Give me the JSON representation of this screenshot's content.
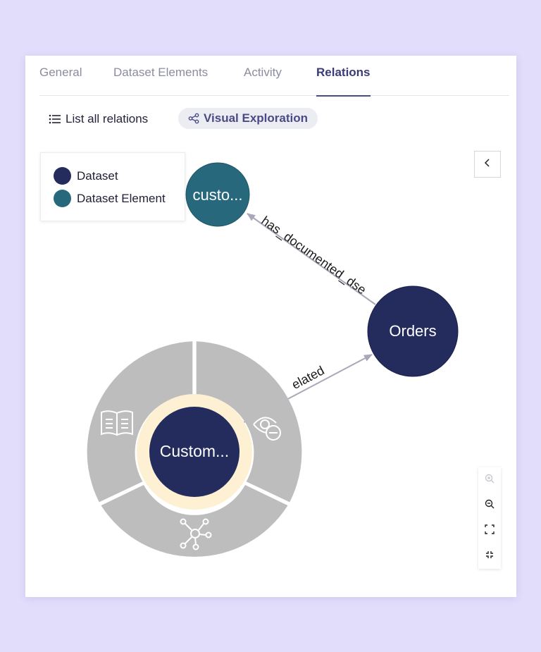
{
  "colors": {
    "background": "#e3ddfc",
    "dataset": "#242c5e",
    "dataset_element": "#27687d",
    "active_tab": "#3b3b78",
    "ring_highlight": "#fdf0d3",
    "radial_menu": "#bdbdbd",
    "edge": "#a8a8b8"
  },
  "tabs": [
    {
      "label": "General",
      "active": false
    },
    {
      "label": "Dataset Elements",
      "active": false
    },
    {
      "label": "Activity",
      "active": false
    },
    {
      "label": "Relations",
      "active": true
    }
  ],
  "subbar": {
    "list_label": "List all relations",
    "list_icon": "list-icon",
    "visual_label": "Visual Exploration",
    "visual_icon": "share-nodes-icon"
  },
  "legend": {
    "items": [
      {
        "label": "Dataset",
        "color_key": "dataset"
      },
      {
        "label": "Dataset Element",
        "color_key": "dataset_element"
      }
    ]
  },
  "graph": {
    "nodes": {
      "customers": {
        "label": "Custom...",
        "type": "Dataset"
      },
      "orders": {
        "label": "Orders",
        "type": "Dataset"
      },
      "customer_element": {
        "label": "custo...",
        "type": "Dataset Element"
      }
    },
    "edges": {
      "related": {
        "label": "elated"
      },
      "documented": {
        "label": "has_documented_dse"
      }
    },
    "radial_menu": {
      "items": [
        {
          "icon": "book-icon"
        },
        {
          "icon": "eye-hide-icon"
        },
        {
          "icon": "network-icon"
        }
      ]
    }
  },
  "controls": {
    "collapse_icon": "chevron-left-icon",
    "zoom": [
      {
        "icon": "zoom-in-icon",
        "enabled": false
      },
      {
        "icon": "zoom-out-icon",
        "enabled": true
      },
      {
        "icon": "fit-view-icon",
        "enabled": true
      },
      {
        "icon": "exit-fullscreen-icon",
        "enabled": true
      }
    ]
  }
}
